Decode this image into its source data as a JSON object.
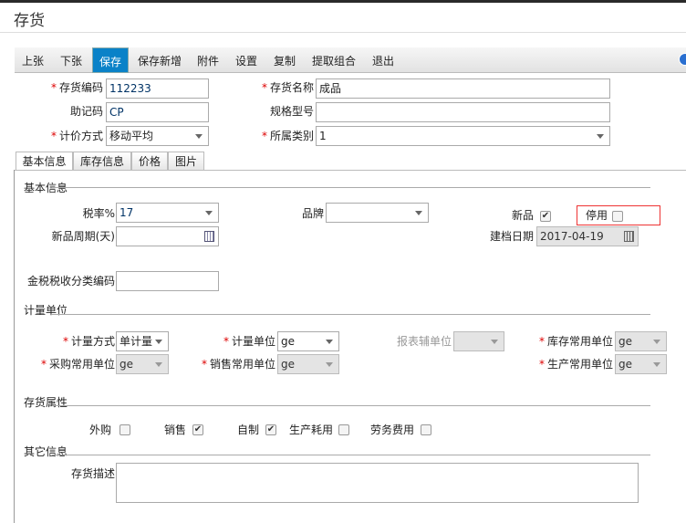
{
  "window": {
    "title": "存货"
  },
  "toolbar": {
    "items": [
      "上张",
      "下张",
      "保存",
      "保存新增",
      "附件",
      "设置",
      "复制",
      "提取组合",
      "退出"
    ],
    "active": "保存"
  },
  "header": {
    "code_label": "存货编码",
    "code_value": "112233",
    "name_label": "存货名称",
    "name_value": "成品",
    "mnemonic_label": "助记码",
    "mnemonic_value": "CP",
    "spec_label": "规格型号",
    "spec_value": "",
    "pricing_label": "计价方式",
    "pricing_value": "移动平均",
    "category_label": "所属类别",
    "category_value": "1"
  },
  "tabs": [
    "基本信息",
    "库存信息",
    "价格",
    "图片"
  ],
  "basic": {
    "section": "基本信息",
    "tax_label": "税率%",
    "tax_value": "17",
    "brand_label": "品牌",
    "brand_value": "",
    "new_label": "新品",
    "new_checked": true,
    "disabled_label": "停用",
    "disabled_checked": false,
    "cycle_label": "新品周期(天)",
    "cycle_value": "",
    "date_label": "建档日期",
    "date_value": "2017-04-19",
    "taxcode_label": "金税税收分类编码",
    "taxcode_value": ""
  },
  "units": {
    "section": "计量单位",
    "method_label": "计量方式",
    "method_value": "单计量",
    "unit_label": "计量单位",
    "unit_value": "ge",
    "report_label": "报表辅单位",
    "report_value": "",
    "stock_label": "库存常用单位",
    "stock_value": "ge",
    "purchase_label": "采购常用单位",
    "purchase_value": "ge",
    "sales_label": "销售常用单位",
    "sales_value": "ge",
    "production_label": "生产常用单位",
    "production_value": "ge"
  },
  "attrs": {
    "section": "存货属性",
    "items": [
      {
        "label": "外购",
        "checked": false
      },
      {
        "label": "销售",
        "checked": true
      },
      {
        "label": "自制",
        "checked": true
      },
      {
        "label": "生产耗用",
        "checked": false
      },
      {
        "label": "劳务费用",
        "checked": false
      }
    ]
  },
  "other": {
    "section": "其它信息",
    "desc_label": "存货描述",
    "desc_value": ""
  }
}
